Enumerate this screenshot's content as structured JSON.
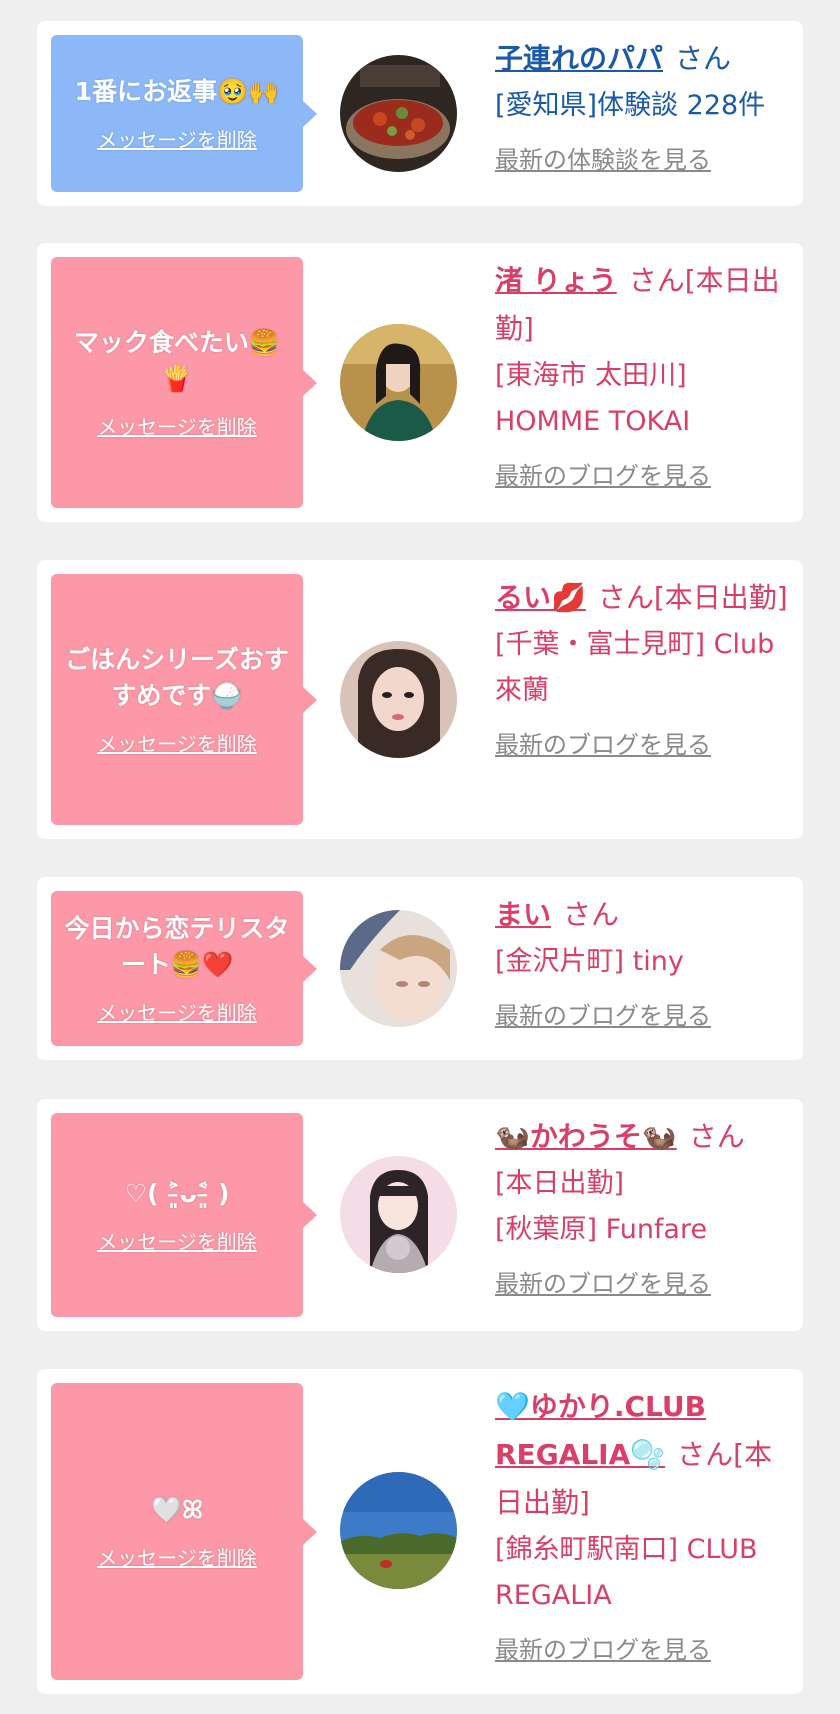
{
  "delete_label": "メッセージを削除",
  "colors": {
    "blue_bubble": "#8cb8f8",
    "pink_bubble": "#fc98a8",
    "blue_text": "#1a5aa8",
    "pink_text": "#d8406a",
    "link_gray": "#8a8a8a"
  },
  "cards": [
    {
      "message": "1番にお返事🥹🙌",
      "name": "子連れのパパ",
      "suffix": "さん",
      "lines": [
        "[愛知県]体験談 228件"
      ],
      "more": "最新の体験談を見る"
    },
    {
      "message": "マック食べたい🍔🍟",
      "name": "渚 りょう",
      "suffix": "さん[本日出勤]",
      "lines": [
        "[東海市 太田川] HOMME TOKAI"
      ],
      "more": "最新のブログを見る"
    },
    {
      "message": "ごはんシリーズおすすめです🍚",
      "name": "るい💋",
      "suffix": "さん[本日出勤]",
      "lines": [
        "[千葉・富士見町] Club 來蘭"
      ],
      "more": "最新のブログを見る"
    },
    {
      "message": "今日から恋テリスタート🍔❤️",
      "name": "まい",
      "suffix": "さん",
      "lines": [
        "[金沢片町] tiny"
      ],
      "more": "最新のブログを見る"
    },
    {
      "message": "♡( ˃̵͈̑ᴗ˂̵͈̑ )",
      "name": "🦦かわうそ🦦",
      "suffix": "さん",
      "lines": [
        "[本日出勤]",
        "[秋葉原] Funfare"
      ],
      "more": "最新のブログを見る"
    },
    {
      "message": "🤍ꕤ",
      "name": "🩵ゆかり.CLUB REGALIA🫧",
      "suffix": "さん[本日出勤]",
      "lines": [
        "[錦糸町駅南口] CLUB REGALIA"
      ],
      "more": "最新のブログを見る"
    }
  ]
}
